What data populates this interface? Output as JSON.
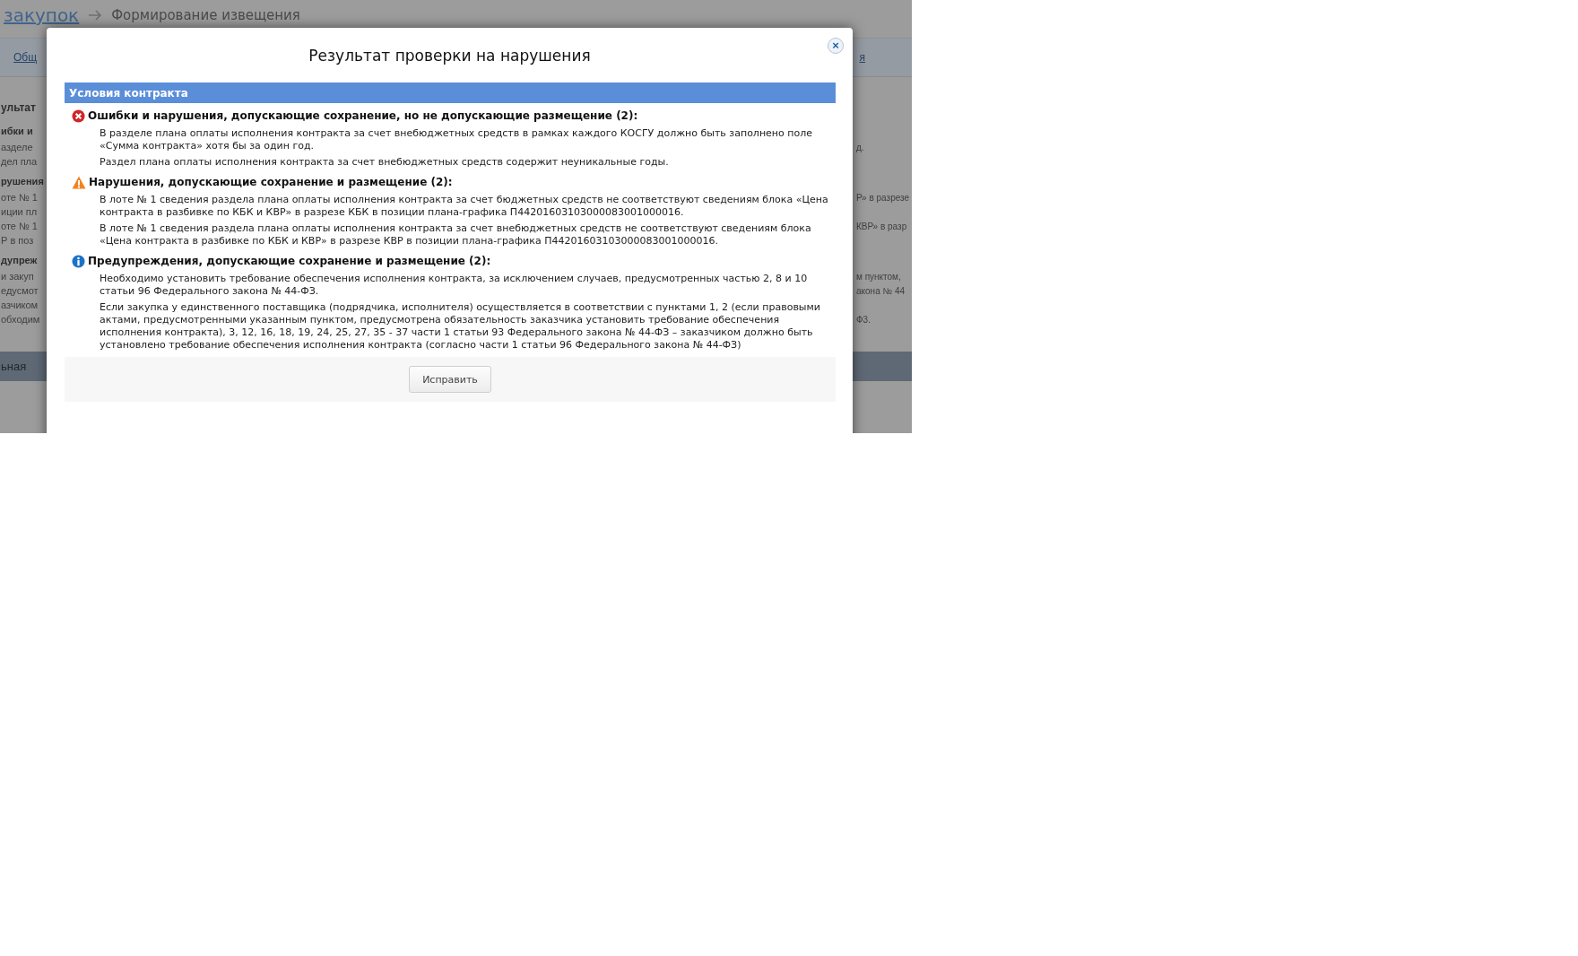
{
  "background_page": {
    "breadcrumb": {
      "link": "закупок",
      "current": "Формирование извещения"
    },
    "tab_left": "Общ",
    "tab_right": "я",
    "rows": [
      {
        "kind": "title",
        "left": "ультат"
      },
      {
        "kind": "bold",
        "left": "ибки и"
      },
      {
        "kind": "text",
        "left": "азделе",
        "right": "д."
      },
      {
        "kind": "text",
        "left": "дел пла"
      },
      {
        "kind": "bold",
        "left": "рушения"
      },
      {
        "kind": "text",
        "left": "оте № 1",
        "right": "Р» в разрезе"
      },
      {
        "kind": "text",
        "left": "иции пл"
      },
      {
        "kind": "text",
        "left": "оте № 1",
        "right": "КВР» в разр"
      },
      {
        "kind": "text",
        "left": "Р в поз"
      },
      {
        "kind": "bold",
        "left": "дупреж"
      },
      {
        "kind": "text",
        "left": "и закуп",
        "right": "м пунктом,"
      },
      {
        "kind": "text",
        "left": "едусмот",
        "right": "акона № 44"
      },
      {
        "kind": "text",
        "left": "азчиком"
      },
      {
        "kind": "text",
        "left": "обходим",
        "right": "Ф3."
      }
    ],
    "bar_text": "ьная"
  },
  "dialog": {
    "title": "Результат проверки на нарушения",
    "close": "×",
    "group_header": "Условия контракта",
    "sections": [
      {
        "kind": "error",
        "heading": "Ошибки и нарушения, допускающие сохранение, но не допускающие размещение (2):",
        "messages": [
          "В разделе плана оплаты исполнения контракта за счет внебюджетных средств в рамках каждого КОСГУ должно быть заполнено поле «Сумма контракта» хотя бы за один год.",
          "Раздел плана оплаты исполнения контракта за счет внебюджетных средств содержит неуникальные годы."
        ]
      },
      {
        "kind": "warning",
        "heading": "Нарушения, допускающие сохранение и размещение (2):",
        "messages": [
          "В лоте № 1 сведения раздела плана оплаты исполнения контракта за счет бюджетных средств не соответствуют сведениям блока «Цена контракта в разбивке по КБК и КВР» в разрезе КБК в позиции плана-графика П44201603103000083001000016.",
          "В лоте № 1 сведения раздела плана оплаты исполнения контракта за счет внебюджетных средств не соответствуют сведениям блока «Цена контракта в разбивке по КБК и КВР» в разрезе КВР в позиции плана-графика П44201603103000083001000016."
        ]
      },
      {
        "kind": "info",
        "heading": "Предупреждения, допускающие сохранение и размещение (2):",
        "messages": [
          "Необходимо установить требование обеспечения исполнения контракта, за исключением случаев, предусмотренных частью 2, 8 и 10 статьи 96 Федерального закона № 44-ФЗ.",
          "Если закупка у единственного поставщика (подрядчика, исполнителя) осуществляется в соответствии с пунктами 1, 2 (если правовыми актами, предусмотренными указанным пунктом, предусмотрена обязательность заказчика установить требование обеспечения исполнения контракта), 3, 12, 16, 18, 19, 24, 25, 27, 35 - 37 части 1 статьи 93 Федерального закона № 44-ФЗ – заказчиком должно быть установлено требование обеспечения исполнения контракта (согласно части 1 статьи 96 Федерального закона № 44-ФЗ)"
        ]
      }
    ],
    "button": "Исправить"
  }
}
